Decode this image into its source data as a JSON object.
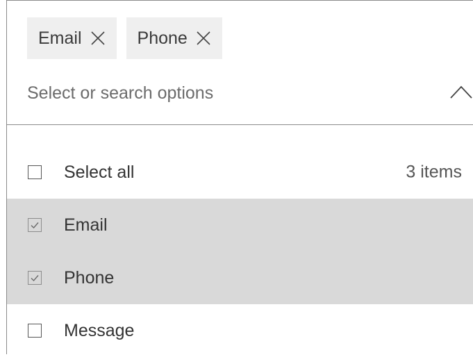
{
  "chips": [
    {
      "label": "Email",
      "remove_icon": "close-icon"
    },
    {
      "label": "Phone",
      "remove_icon": "close-icon"
    }
  ],
  "search": {
    "placeholder": "Select or search options",
    "value": "",
    "toggle_icon": "chevron-up-icon"
  },
  "select_all": {
    "label": "Select all",
    "count_label": "3 items",
    "checked": false
  },
  "options": [
    {
      "label": "Email",
      "checked": true
    },
    {
      "label": "Phone",
      "checked": true
    },
    {
      "label": "Message",
      "checked": false
    }
  ],
  "colors": {
    "chip_background": "#efefef",
    "selected_row": "#d9d9d9",
    "border": "#8a8a8a"
  }
}
